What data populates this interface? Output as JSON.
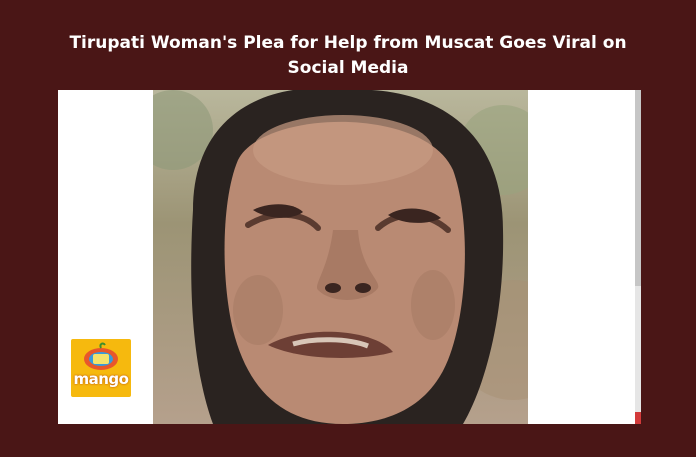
{
  "headline": {
    "line1": "Tirupati Woman's Plea for Help from Muscat Goes Viral on",
    "line2": "Social Media"
  },
  "logo": {
    "text": "mango"
  },
  "photo": {
    "subject": "woman-crying-face"
  },
  "colors": {
    "background": "#4a1616",
    "headline_text": "#ffffff",
    "logo_bg": "#f6b90e"
  }
}
